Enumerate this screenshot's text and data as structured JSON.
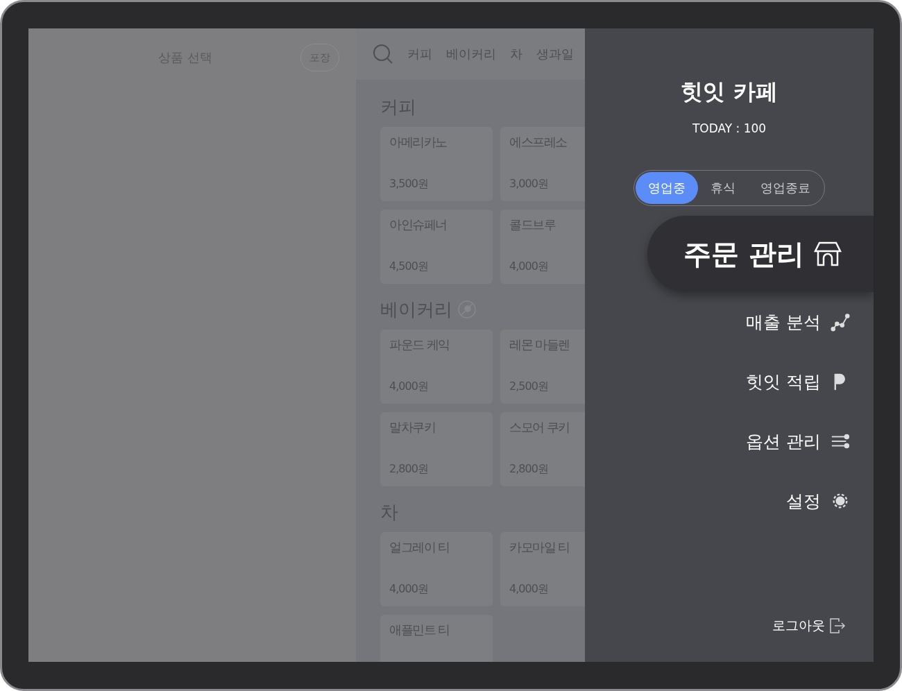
{
  "order_panel": {
    "title": "상품 선택",
    "takeout_button": "포장"
  },
  "category_tabs": [
    "커피",
    "베이커리",
    "차",
    "생과일"
  ],
  "sections": [
    {
      "title": "커피",
      "no_takeout": false,
      "products": [
        {
          "name": "아메리카노",
          "price": "3,500원"
        },
        {
          "name": "에스프레소",
          "price": "3,000원"
        },
        {
          "name": "아인슈페너",
          "price": "4,500원"
        },
        {
          "name": "콜드브루",
          "price": "4,000원"
        }
      ]
    },
    {
      "title": "베이커리",
      "no_takeout": true,
      "products": [
        {
          "name": "파운드 케익",
          "price": "4,000원"
        },
        {
          "name": "레몬 마들렌",
          "price": "2,500원"
        },
        {
          "name": "말차쿠키",
          "price": "2,800원"
        },
        {
          "name": "스모어 쿠키",
          "price": "2,800원"
        }
      ]
    },
    {
      "title": "차",
      "no_takeout": false,
      "products": [
        {
          "name": "얼그레이 티",
          "price": "4,000원"
        },
        {
          "name": "카모마일 티",
          "price": "4,000원"
        },
        {
          "name": "애플민트 티"
        }
      ]
    }
  ],
  "drawer": {
    "title": "힛잇 카페",
    "today": "TODAY : 100",
    "status_options": [
      {
        "label": "영업중",
        "selected": true
      },
      {
        "label": "휴식",
        "selected": false
      },
      {
        "label": "영업종료",
        "selected": false
      }
    ],
    "menu": [
      {
        "label": "주문 관리",
        "kind": "store",
        "selected": true
      },
      {
        "label": "매출 분석",
        "kind": "chart",
        "selected": false
      },
      {
        "label": "힛잇 적립",
        "kind": "flag",
        "selected": false
      },
      {
        "label": "옵션 관리",
        "kind": "options",
        "selected": false
      },
      {
        "label": "설정",
        "kind": "settings",
        "selected": false
      }
    ],
    "logout": "로그아웃"
  }
}
